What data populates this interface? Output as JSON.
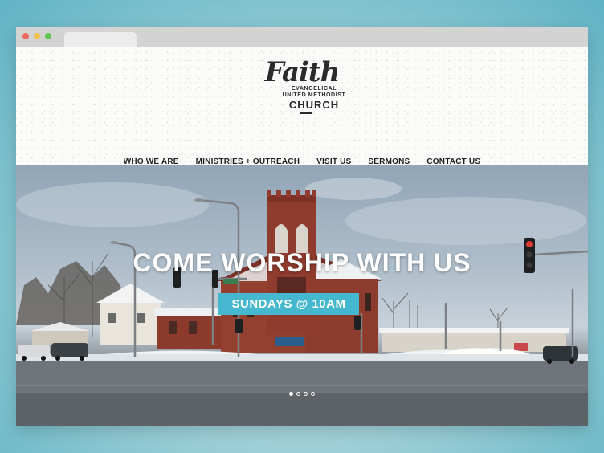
{
  "logo": {
    "script": "Faith",
    "line1": "EVANGELICAL",
    "line2": "UNITED METHODIST",
    "church": "CHURCH"
  },
  "nav": {
    "items": [
      {
        "label": "WHO WE ARE"
      },
      {
        "label": "MINISTRIES + OUTREACH"
      },
      {
        "label": "VISIT US"
      },
      {
        "label": "SERMONS"
      },
      {
        "label": "CONTACT US"
      }
    ]
  },
  "hero": {
    "title": "COME WORSHIP WITH US",
    "badge": "SUNDAYS @ 10AM",
    "slides_total": 4,
    "slide_active": 1
  },
  "colors": {
    "accent": "#45b7cf",
    "text_dark": "#1e1e1e"
  }
}
